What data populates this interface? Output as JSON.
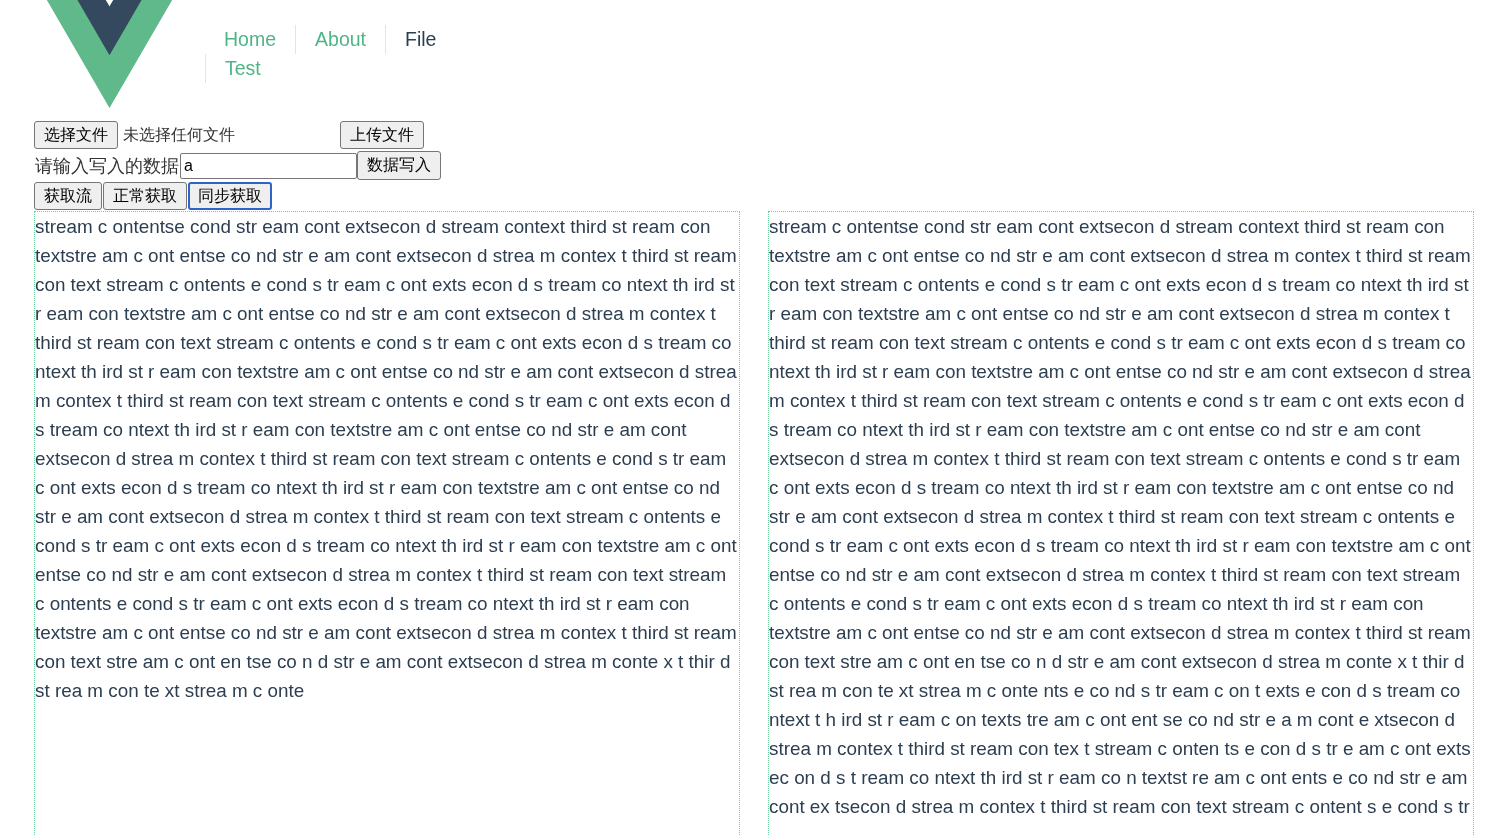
{
  "nav": {
    "links": [
      {
        "label": "Home",
        "selected": false
      },
      {
        "label": "About",
        "selected": false
      },
      {
        "label": "File",
        "selected": true
      },
      {
        "label": "Test",
        "selected": false
      }
    ]
  },
  "upload": {
    "choose_button": "选择文件",
    "file_status": "未选择任何文件",
    "upload_button": "上传文件"
  },
  "write": {
    "label": "请输入写入的数据",
    "value": "a",
    "button": "数据写入"
  },
  "fetch_buttons": [
    {
      "label": "获取流",
      "focused": false
    },
    {
      "label": "正常获取",
      "focused": false
    },
    {
      "label": "同步获取",
      "focused": true
    }
  ],
  "panels": [
    {
      "text": "stream c ontentse cond str eam cont extsecon d stream context third st ream con textstre am c ont entse co nd str e am cont extsecon d strea m contex t third st ream con text stream c ontents e cond s tr eam c ont exts econ d s tream co ntext th ird st r eam con textstre am c ont entse co nd str e am cont extsecon d strea m contex t third st ream con text stream c ontents e cond s tr eam c ont exts econ d s tream co ntext th ird st r eam con textstre am c ont entse co nd str e am cont extsecon d strea m contex t third st ream con text stream c ontents e cond s tr eam c ont exts econ d s tream co ntext th ird st r eam con textstre am c ont entse co nd str e am cont extsecon d strea m contex t third st ream con text stream c ontents e cond s tr eam c ont exts econ d s tream co ntext th ird st r eam con textstre am c ont entse co nd str e am cont extsecon d strea m contex t third st ream con text stream c ontents e cond s tr eam c ont exts econ d s tream co ntext th ird st r eam con textstre am c ont entse co nd str e am cont extsecon d strea m contex t third st ream con text stream c ontents e cond s tr eam c ont exts econ d s tream co ntext th ird st r eam con textstre am c ont entse co nd str e am cont extsecon d strea m contex t third st ream con text stre am c ont en tse co n d str e am cont extsecon d strea m conte x t thir d st rea m con te xt strea m c onte"
    },
    {
      "text": "stream c ontentse cond str eam cont extsecon d stream context third st ream con textstre am c ont entse co nd str e am cont extsecon d strea m contex t third st ream con text stream c ontents e cond s tr eam c ont exts econ d s tream co ntext th ird st r eam con textstre am c ont entse co nd str e am cont extsecon d strea m contex t third st ream con text stream c ontents e cond s tr eam c ont exts econ d s tream co ntext th ird st r eam con textstre am c ont entse co nd str e am cont extsecon d strea m contex t third st ream con text stream c ontents e cond s tr eam c ont exts econ d s tream co ntext th ird st r eam con textstre am c ont entse co nd str e am cont extsecon d strea m contex t third st ream con text stream c ontents e cond s tr eam c ont exts econ d s tream co ntext th ird st r eam con textstre am c ont entse co nd str e am cont extsecon d strea m contex t third st ream con text stream c ontents e cond s tr eam c ont exts econ d s tream co ntext th ird st r eam con textstre am c ont entse co nd str e am cont extsecon d strea m contex t third st ream con text stream c ontents e cond s tr eam c ont exts econ d s tream co ntext th ird st r eam con textstre am c ont entse co nd str e am cont extsecon d strea m contex t third st ream con text stre am c ont en tse co n d str e am cont extsecon d strea m conte x t thir d st rea m con te xt strea m c onte nts e co nd s tr eam c on t exts e con d s tream co ntext t h ird st r eam c on texts tre am c ont ent se co nd str e a m cont e xtsecon d strea m contex t third st ream con tex t stream c onten ts e con d s tr e am c ont exts ec on d s t ream co ntext th ird st r eam co n textst re am c ont ents e co nd str e am cont ex tsecon d strea m contex t third st ream con text stream c ontent s e cond s tr"
    }
  ]
}
